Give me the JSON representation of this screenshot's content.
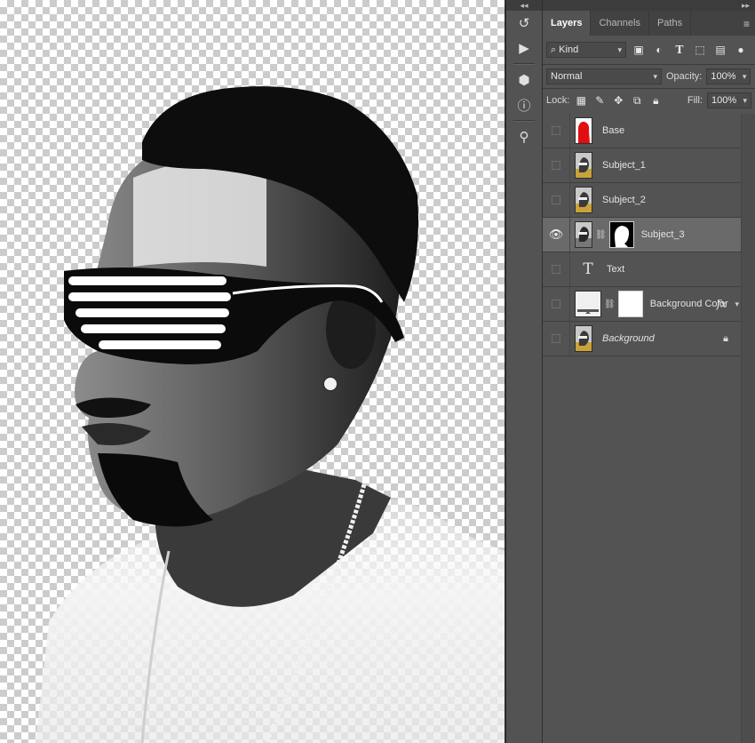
{
  "app": {
    "collapse_left": "◂◂",
    "collapse_right": "▸▸"
  },
  "toolstrip": {
    "items": [
      {
        "name": "history-icon",
        "glyph": "↺"
      },
      {
        "name": "play-icon",
        "glyph": "▶"
      },
      {
        "name": "3d-cube-icon",
        "glyph": "⬢"
      },
      {
        "name": "info-icon",
        "glyph": "ⓘ"
      },
      {
        "name": "clone-source-icon",
        "glyph": "⚲"
      }
    ]
  },
  "panel": {
    "tabs": [
      "Layers",
      "Channels",
      "Paths"
    ],
    "active_tab": "Layers",
    "menu_glyph": "≡",
    "filter": {
      "value": "Kind",
      "glyph": "⌕"
    },
    "filter_icons": [
      "image-filter-icon",
      "adjustment-filter-icon",
      "type-filter-icon",
      "shape-filter-icon",
      "smart-object-filter-icon"
    ],
    "blend_mode": "Normal",
    "opacity_label": "Opacity:",
    "opacity_value": "100%",
    "lock_label": "Lock:",
    "fill_label": "Fill:",
    "fill_value": "100%"
  },
  "layers": [
    {
      "name": "Base",
      "visible": false,
      "kind": "red"
    },
    {
      "name": "Subject_1",
      "visible": false,
      "kind": "portrait"
    },
    {
      "name": "Subject_2",
      "visible": false,
      "kind": "portrait"
    },
    {
      "name": "Subject_3",
      "visible": true,
      "kind": "portrait-mask",
      "selected": true
    },
    {
      "name": "Text",
      "visible": false,
      "kind": "text"
    },
    {
      "name": "Background Color",
      "visible": false,
      "kind": "fill",
      "fx": "fx"
    },
    {
      "name": "Background",
      "visible": false,
      "kind": "portrait",
      "italic": true,
      "locked": true
    }
  ],
  "colors": {
    "panel_bg": "#535353",
    "selected_row": "#6a6a6a",
    "base_red": "#e01010",
    "mustard": "#c9a23a"
  }
}
